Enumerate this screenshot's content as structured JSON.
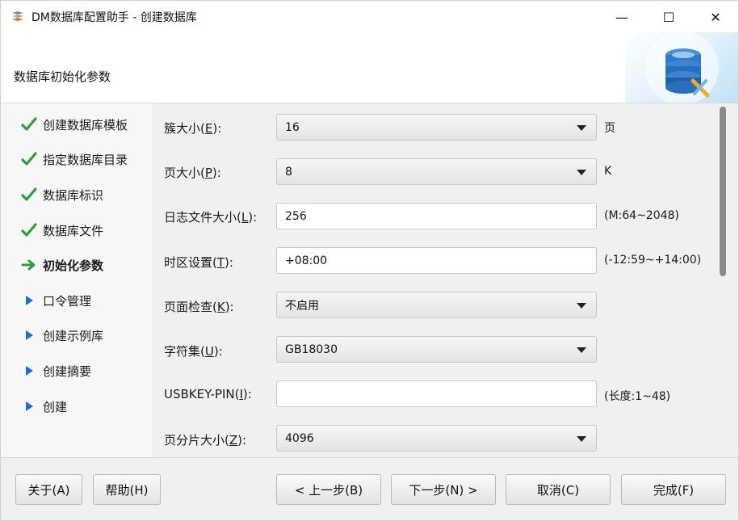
{
  "window": {
    "title": "DM数据库配置助手 - 创建数据库",
    "min_glyph": "—",
    "max_glyph": "☐",
    "close_glyph": "✕"
  },
  "header": {
    "title": "数据库初始化参数"
  },
  "sidebar": {
    "steps": [
      {
        "label": "创建数据库模板",
        "status": "done",
        "icon": "check-icon"
      },
      {
        "label": "指定数据库目录",
        "status": "done",
        "icon": "check-icon"
      },
      {
        "label": "数据库标识",
        "status": "done",
        "icon": "check-icon"
      },
      {
        "label": "数据库文件",
        "status": "done",
        "icon": "check-icon"
      },
      {
        "label": "初始化参数",
        "status": "current",
        "icon": "arrow-right-icon"
      },
      {
        "label": "口令管理",
        "status": "pending",
        "icon": "triangle-right-icon"
      },
      {
        "label": "创建示例库",
        "status": "pending",
        "icon": "triangle-right-icon"
      },
      {
        "label": "创建摘要",
        "status": "pending",
        "icon": "triangle-right-icon"
      },
      {
        "label": "创建",
        "status": "pending",
        "icon": "triangle-right-icon"
      }
    ]
  },
  "form": {
    "extent_size": {
      "label_pre": "簇大小(",
      "mnemonic": "E",
      "label_post": "):",
      "value": "16",
      "hint": "页"
    },
    "page_size": {
      "label_pre": "页大小(",
      "mnemonic": "P",
      "label_post": "):",
      "value": "8",
      "hint": "K"
    },
    "log_size": {
      "label_pre": "日志文件大小(",
      "mnemonic": "L",
      "label_post": "):",
      "value": "256",
      "hint": "(M:64~2048)"
    },
    "time_zone": {
      "label_pre": "时区设置(",
      "mnemonic": "T",
      "label_post": "):",
      "value": "+08:00",
      "hint": "(-12:59~+14:00)"
    },
    "page_check": {
      "label_pre": "页面检查(",
      "mnemonic": "K",
      "label_post": "):",
      "value": "不启用"
    },
    "charset": {
      "label_pre": "字符集(",
      "mnemonic": "U",
      "label_post": "):",
      "value": "GB18030"
    },
    "usbkey_pin": {
      "label_pre": "USBKEY-PIN(",
      "mnemonic": "I",
      "label_post": "):",
      "value": "",
      "hint": "(长度:1~48)"
    },
    "page_shard_size": {
      "label_pre": "页分片大小(",
      "mnemonic": "Z",
      "label_post": "):",
      "value": "4096"
    }
  },
  "footer": {
    "about": "关于(A)",
    "help": "帮助(H)",
    "back": "< 上一步(B)",
    "next": "下一步(N) >",
    "cancel": "取消(C)",
    "finish": "完成(F)"
  },
  "colors": {
    "check_green": "#2e9e3a",
    "arrow_green": "#2e9e3a",
    "triangle_blue": "#1a6fd6",
    "content_bg": "#f0f0f0"
  }
}
